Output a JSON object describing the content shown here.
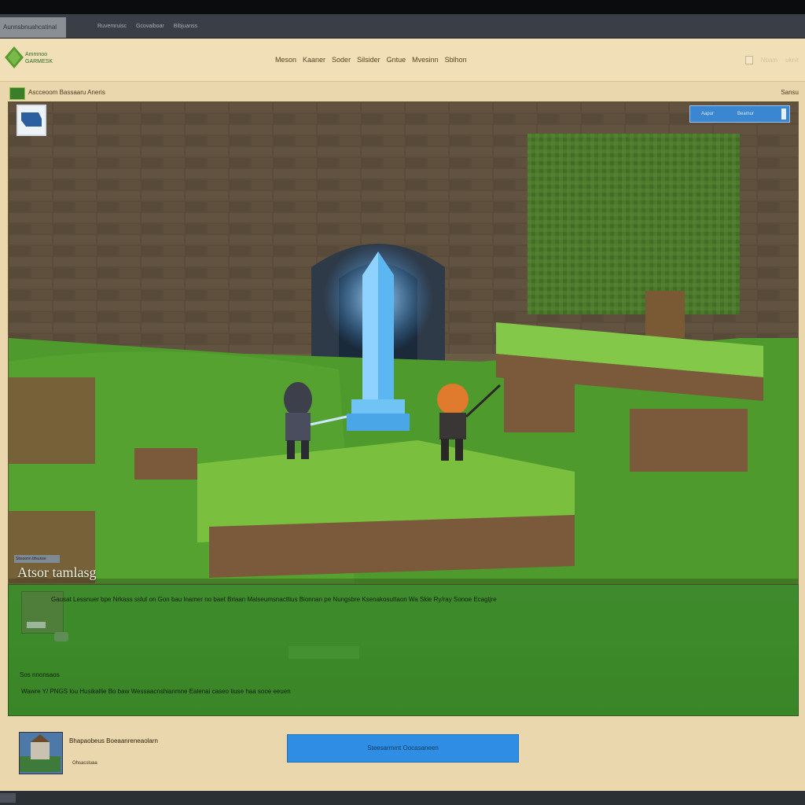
{
  "browser": {
    "tab_title": "Aunnsbnuahcatinal",
    "links": [
      "Ruvemruisc",
      "Gcovaiboar",
      "Bibjuanss"
    ]
  },
  "header": {
    "brand_line1": "Ammnoo",
    "brand_line2": "GARMESK",
    "nav": [
      "Meson",
      "Kaaner",
      "Soder",
      "Silsider",
      "Gntue",
      "Mvesinn",
      "Sblhon"
    ],
    "right": [
      "",
      "Nbam",
      "uknit"
    ]
  },
  "game": {
    "title": "Ascceoom Bassaaru Aneris",
    "right_label": "Sansu",
    "hud_label": "Aapur",
    "hud_value": "Beamur",
    "overlay_tag": "Sbsoonn bfsunse",
    "overlay_title": "Atsor tamlasg"
  },
  "description": {
    "paragraph": "Gausat Lessnuer bpe Nrkass sslut on Gon bau lnamer no baet Briaan Malseumsnacttius Bionnan pe Nungsbre Ksenakosuttaon Wa Skie Ry/ray Sonoe Ecagtjre",
    "subheading": "Sos nnonsaos",
    "footer_line": "Wawre Y/ PNGS lou Husikallie Bo baw Wessaacnshianmne Ealenai caseo tiuse haa sooe eeuen"
  },
  "footer": {
    "thumb_title": "Bhapaobeus Boeaanreneaolarn",
    "thumb_sub": "Ohsacsluaa",
    "cta_label": "Steesarmmt Oocasaneen"
  },
  "colors": {
    "page_bg": "#ebd7ad",
    "accent_blue": "#2f8ee3",
    "grass_green": "#3c8a2a",
    "wall_brown": "#6b5c46"
  }
}
